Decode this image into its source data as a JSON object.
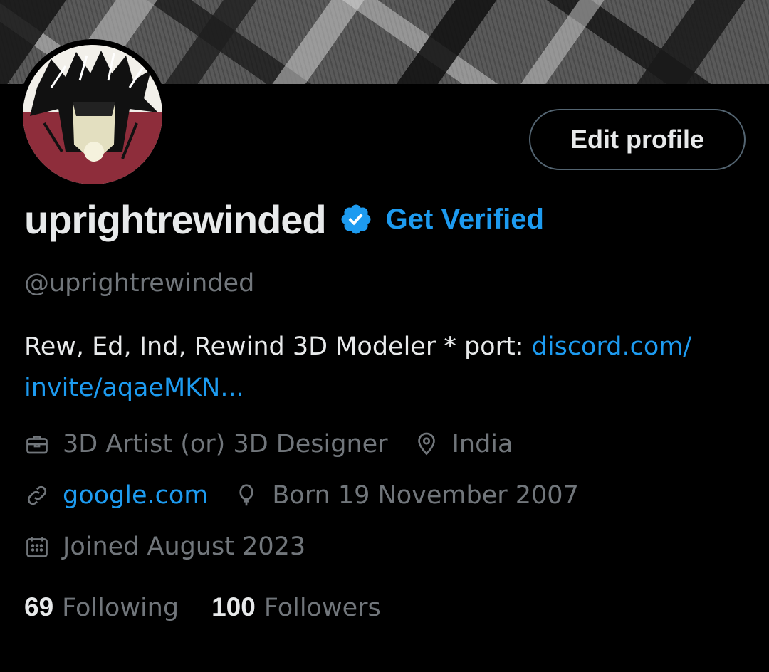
{
  "profile": {
    "display_name": "uprightrewinded",
    "handle": "@uprightrewinded",
    "get_verified_label": "Get Verified",
    "edit_profile_label": "Edit profile",
    "bio_text": "Rew, Ed, Ind, Rewind  3D Modeler * port: ",
    "bio_link_line1": "discord.com/",
    "bio_link_line2": "invite/aqaeMKN...",
    "profession": "3D Artist (or) 3D Designer",
    "location": "India",
    "website": "google.com",
    "birthday": "Born 19 November 2007",
    "joined": "Joined August 2023",
    "following_count": "69",
    "following_label": "Following",
    "followers_count": "100",
    "followers_label": "Followers"
  },
  "icons": {
    "profession": "briefcase-icon",
    "location": "map-pin-icon",
    "website": "link-icon",
    "birthday": "balloon-icon",
    "joined": "calendar-icon",
    "verified": "verified-badge-icon"
  },
  "colors": {
    "accent": "#1d9bf0",
    "background": "#000000",
    "primary_text": "#e7e9ea",
    "secondary_text": "#71767b",
    "button_border": "#536471"
  }
}
